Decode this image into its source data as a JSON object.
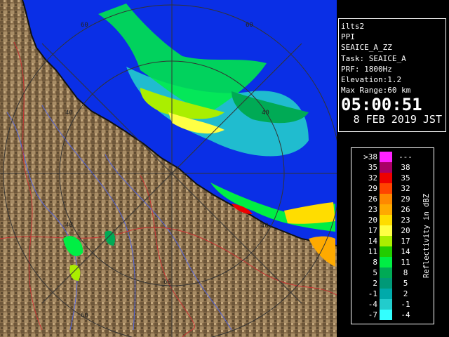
{
  "map": {
    "range_ring_labels": [
      "40",
      "40",
      "40",
      "40",
      "60",
      "60",
      "60",
      "60"
    ]
  },
  "info": {
    "lines": [
      "ilts2",
      "PPI",
      "SEAICE_A_ZZ",
      "Task: SEAICE_A",
      "PRF: 1800Hz",
      "Elevation:1.2",
      "Max Range:60 km"
    ],
    "time": "05:00:51",
    "date": "8 FEB 2019 JST"
  },
  "legend": {
    "title": "Reflectivity in dBZ",
    "rows": [
      {
        "lo": ">38",
        "hi": "---",
        "color": "#ff22ff"
      },
      {
        "lo": "35",
        "hi": "38",
        "color": "#aa0066"
      },
      {
        "lo": "32",
        "hi": "35",
        "color": "#ee0000"
      },
      {
        "lo": "29",
        "hi": "32",
        "color": "#ff4400"
      },
      {
        "lo": "26",
        "hi": "29",
        "color": "#ff8800"
      },
      {
        "lo": "23",
        "hi": "26",
        "color": "#ffaa00"
      },
      {
        "lo": "20",
        "hi": "23",
        "color": "#ffdd00"
      },
      {
        "lo": "17",
        "hi": "20",
        "color": "#ffff44"
      },
      {
        "lo": "14",
        "hi": "17",
        "color": "#aaee00"
      },
      {
        "lo": "11",
        "hi": "14",
        "color": "#22cc00"
      },
      {
        "lo": "8",
        "hi": "11",
        "color": "#00ee44"
      },
      {
        "lo": "5",
        "hi": "8",
        "color": "#00aa55"
      },
      {
        "lo": "2",
        "hi": "5",
        "color": "#009977"
      },
      {
        "lo": "-1",
        "hi": "2",
        "color": "#00aaaa"
      },
      {
        "lo": "-4",
        "hi": "-1",
        "color": "#22cccc"
      },
      {
        "lo": "-7",
        "hi": "-4",
        "color": "#33ffff"
      }
    ]
  },
  "colors": {
    "sea": "#0a2fe6",
    "land": "#8a6f4c",
    "panel": "#000000"
  }
}
